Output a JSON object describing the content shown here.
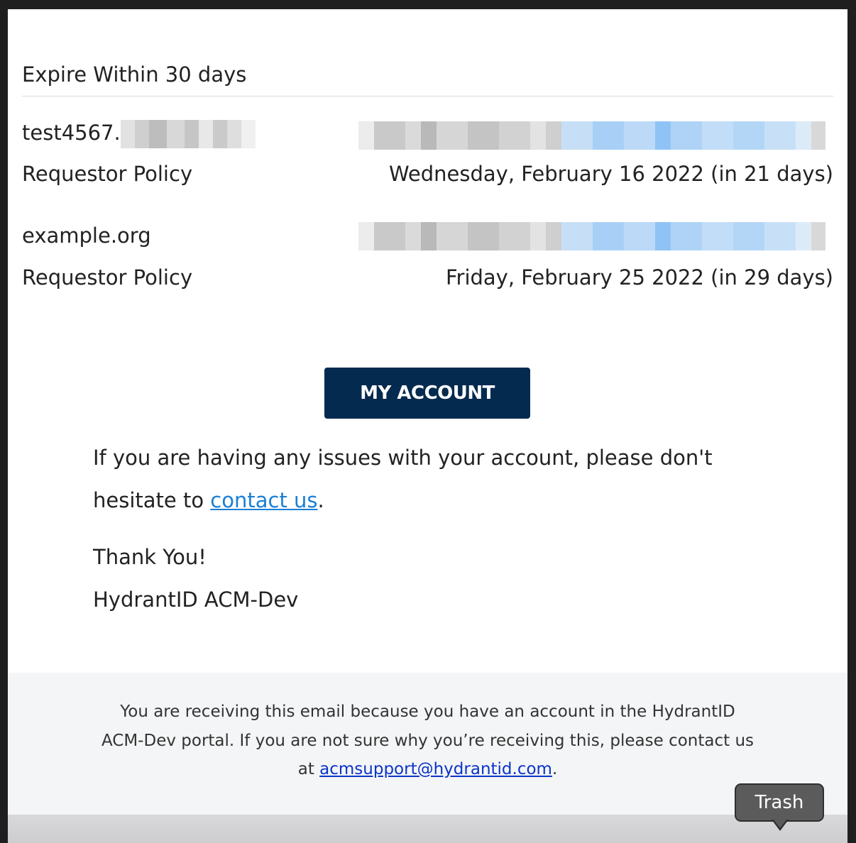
{
  "section": {
    "title": "Expire Within 30 days"
  },
  "certificates": [
    {
      "domain": "test4567.",
      "policy": "Requestor Policy",
      "expiry": "Wednesday, February 16 2022 (in 21 days)"
    },
    {
      "domain": "example.org",
      "policy": "Requestor Policy",
      "expiry": "Friday, February 25 2022 (in 29 days)"
    }
  ],
  "button": {
    "label": "MY ACCOUNT"
  },
  "message": {
    "line1": "If you are having any issues with your account, please don't",
    "line2_prefix": "hesitate to ",
    "link": "contact us",
    "line2_suffix": ".",
    "thanks": "Thank You!",
    "signature": "HydrantID ACM-Dev"
  },
  "footer": {
    "line1": "You are receiving this email because you have an account in the HydrantID",
    "line2": "ACM-Dev portal. If you are not sure why you’re receiving this, please contact us",
    "line3_prefix": "at ",
    "email": "acmsupport@hydrantid.com",
    "line3_suffix": "."
  },
  "tooltip": {
    "label": "Trash"
  },
  "colors": {
    "button_bg": "#042a4f",
    "link": "#1a7fd4",
    "footer_link": "#0a35c9",
    "footer_bg": "#f4f5f6"
  }
}
